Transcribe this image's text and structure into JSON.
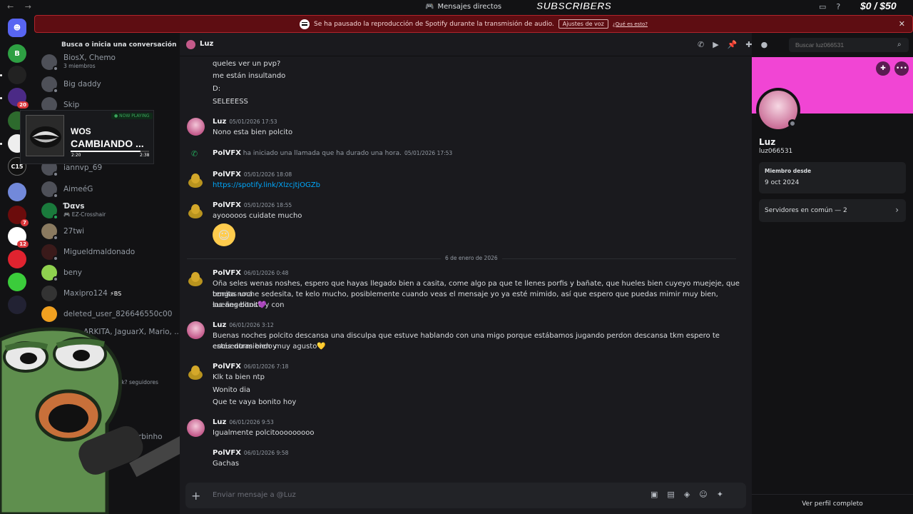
{
  "topbar": {
    "nav": "← →",
    "title": "Mensajes directos",
    "overlay_title": "SUBSCRIBERS",
    "money": "$0 / $50"
  },
  "banner": {
    "text": "Se ha pausado la reproducción de Spotify durante la transmisión de audio.",
    "button": "Ajustes de voz",
    "link": "¿Qué es esto?",
    "close": "✕"
  },
  "rail": {
    "badges": [
      "20",
      "7",
      "12"
    ],
    "labels": [
      "B",
      "C15"
    ]
  },
  "dm": {
    "search": "Busca o inicia una conversación",
    "items": [
      {
        "name": "BiosX, Chemo",
        "sub": "3 miembros"
      },
      {
        "name": "Big daddy",
        "sub": ""
      },
      {
        "name": "Skip",
        "sub": ""
      },
      {
        "name": "iannvp_69",
        "sub": ""
      },
      {
        "name": "AimeéG",
        "sub": ""
      },
      {
        "name": "Ɗαvs",
        "sub": "🎮 EZ-Crosshair"
      },
      {
        "name": "27twi",
        "sub": ""
      },
      {
        "name": "Migueldmaldonado",
        "sub": ""
      },
      {
        "name": "beny",
        "sub": ""
      },
      {
        "name": "Maxipro124",
        "sub": "",
        "badge": "⚡BS"
      },
      {
        "name": "deleted_user_826646550c00",
        "sub": ""
      },
      {
        "name": "ARKITA, JaguarX, Mario, ...",
        "sub": ""
      },
      {
        "name": "",
        "sub": "300k? seguidores"
      },
      {
        "name": "masturbinho",
        "sub": ""
      }
    ]
  },
  "now_playing": {
    "tag": "● NOW PLAYING",
    "artist": "WOS",
    "song": "CAMBIANDO ...",
    "elapsed": "2:20",
    "total": "2:38",
    "progress": 0.89
  },
  "chat": {
    "recipient": "Luz",
    "messages": [
      {
        "lines": [
          "queles ver un  pvp?",
          "me están  insultando",
          "D:",
          "SELEEESS"
        ]
      },
      {
        "author": "Luz",
        "time": "05/01/2026 17:53",
        "lines": [
          "Nono esta bien polcito"
        ]
      },
      {
        "call": "PolVFX",
        "call_text": " ha iniciado una llamada que ha durado una hora.",
        "time": "05/01/2026 17:53"
      },
      {
        "author": "PolVFX",
        "time": "05/01/2026 18:08",
        "link": "https://spotify.link/XlzcjtjOGZb"
      },
      {
        "author": "PolVFX",
        "time": "05/01/2026 18:55",
        "lines": [
          "ayooooos cuidate mucho"
        ],
        "emoji": "☺"
      },
      {
        "divider": "6 de enero de 2026"
      },
      {
        "author": "PolVFX",
        "time": "06/01/2026 0:48",
        "lines": [
          "Oña seles wenas noshes, espero que hayas llegado bien a casita, come algo pa que te llenes porfis y bañate, que hueles bien cuyeyo muejeje, que tengas una",
          "bonita noche sedesita, te kelo mucho, posiblemente cuando veas el mensaje yo ya esté mimido, así que espero que puedas mimir muy bien, sueñes bonito y con",
          "los angelitos💜"
        ]
      },
      {
        "author": "Luz",
        "time": "06/01/2026 3:12",
        "lines": [
          "Buenas noches polcito descansa una disculpa que estuve hablando con una migo porque estábamos jugando perdon descansa tkm espero te encuentras bien y",
          "estés durmiendo muy agusto💛"
        ]
      },
      {
        "author": "PolVFX",
        "time": "06/01/2026 7:18",
        "lines": [
          "Klk ta bien ntp",
          "Wonito dia",
          "Que te vaya bonito hoy"
        ]
      },
      {
        "author": "Luz",
        "time": "06/01/2026 9:53",
        "lines": [
          "Igualmente polcitooooooooo"
        ]
      },
      {
        "author": "PolVFX",
        "time": "06/01/2026 9:58",
        "lines": [
          "Gachas"
        ]
      }
    ],
    "composer_placeholder": "Enviar mensaje a @Luz",
    "search_placeholder": "Buscar luz066531"
  },
  "profile": {
    "name": "Luz",
    "username": "luz066531",
    "member_label": "Miembro desde",
    "member_since": "9 oct 2024",
    "mutual": "Servidores en común — 2",
    "full_profile": "Ver perfil completo",
    "banner_color": "#f145d4"
  }
}
